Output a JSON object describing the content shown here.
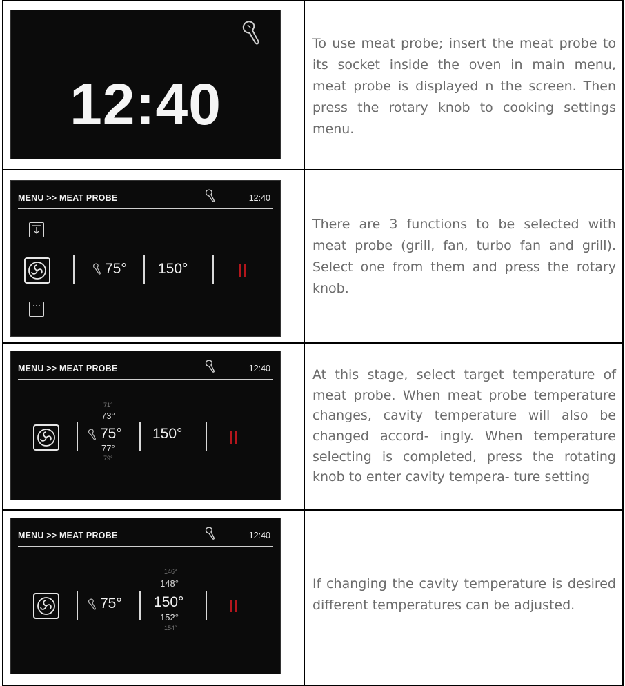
{
  "rows": [
    {
      "screen": {
        "time": "12:40",
        "icon": "meat-probe-icon"
      },
      "text": "To use meat probe; insert the meat probe to its socket inside the oven in main menu, meat probe is displayed n the screen. Then press the rotary knob to cooking settings menu."
    },
    {
      "screen": {
        "title": "MENU >> MEAT PROBE",
        "time": "12:40",
        "probe_temp": "75°",
        "cavity_temp": "150°",
        "icons": [
          "grill-icon",
          "fan-icon",
          "turbo-fan-icon",
          "meat-probe-icon",
          "pause-icon"
        ]
      },
      "text": "There are 3 functions to be selected with meat probe (grill, fan, turbo fan and grill). Select one from them and press the rotary knob."
    },
    {
      "screen": {
        "title": "MENU >> MEAT PROBE",
        "time": "12:40",
        "probe_temp": "75°",
        "cavity_temp": "150°",
        "probe_above_far": "71°",
        "probe_above": "73°",
        "probe_below": "77°",
        "probe_below_far": "79°"
      },
      "text": "At this stage, select target temperature of meat probe. When meat probe temperature changes, cavity temperature will also be changed accord- ingly. When temperature selecting is completed, press the rotating knob to enter cavity tempera- ture setting"
    },
    {
      "screen": {
        "title": "MENU >> MEAT PROBE",
        "time": "12:40",
        "probe_temp": "75°",
        "cavity_temp": "150°",
        "cavity_above_far": "146°",
        "cavity_above": "148°",
        "cavity_below": "152°",
        "cavity_below_far": "154°"
      },
      "text": "If changing the cavity temperature is desired different temperatures can be adjusted."
    }
  ]
}
